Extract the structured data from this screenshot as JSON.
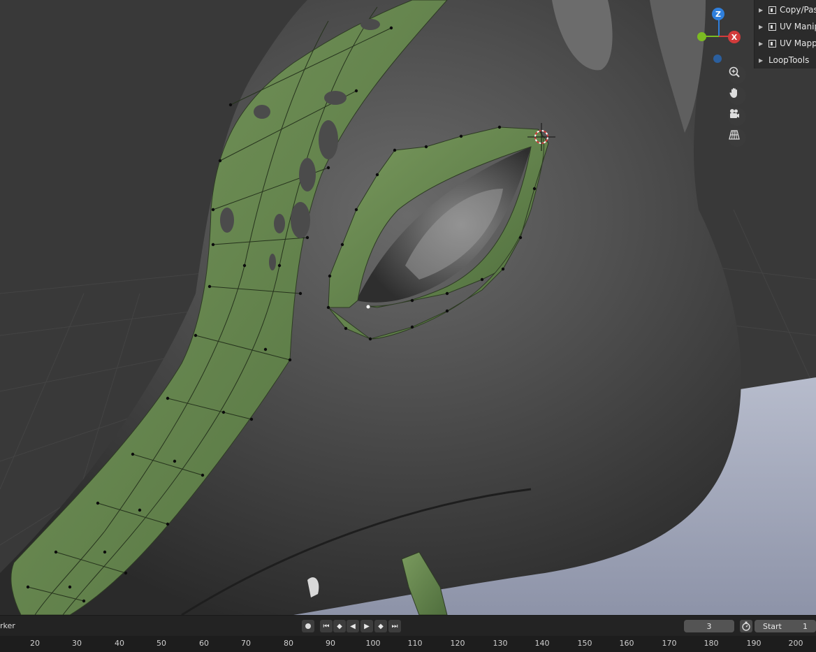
{
  "viewport": {
    "gizmo": {
      "z_label": "Z",
      "x_label": "X"
    },
    "nav_buttons": [
      {
        "icon": "zoom-icon"
      },
      {
        "icon": "hand-pan-icon"
      },
      {
        "icon": "camera-icon"
      },
      {
        "icon": "grid-perspective-icon"
      }
    ]
  },
  "addons_panel": {
    "items": [
      {
        "label": "Copy/Paste"
      },
      {
        "label": "UV Manipulation"
      },
      {
        "label": "UV Mapping"
      },
      {
        "label": "LoopTools"
      }
    ]
  },
  "timeline": {
    "marker_label": "rker",
    "current_frame": "3",
    "start_label": "Start",
    "start_value": "1",
    "playback_buttons": [
      "jump-start-icon",
      "keyframe-prev-icon",
      "play-reverse-icon",
      "play-icon",
      "keyframe-next-icon",
      "jump-end-icon"
    ],
    "ruler_ticks": [
      "20",
      "30",
      "40",
      "50",
      "60",
      "70",
      "80",
      "90",
      "100",
      "110",
      "120",
      "130",
      "140",
      "150",
      "160",
      "170",
      "180",
      "190",
      "200"
    ]
  }
}
